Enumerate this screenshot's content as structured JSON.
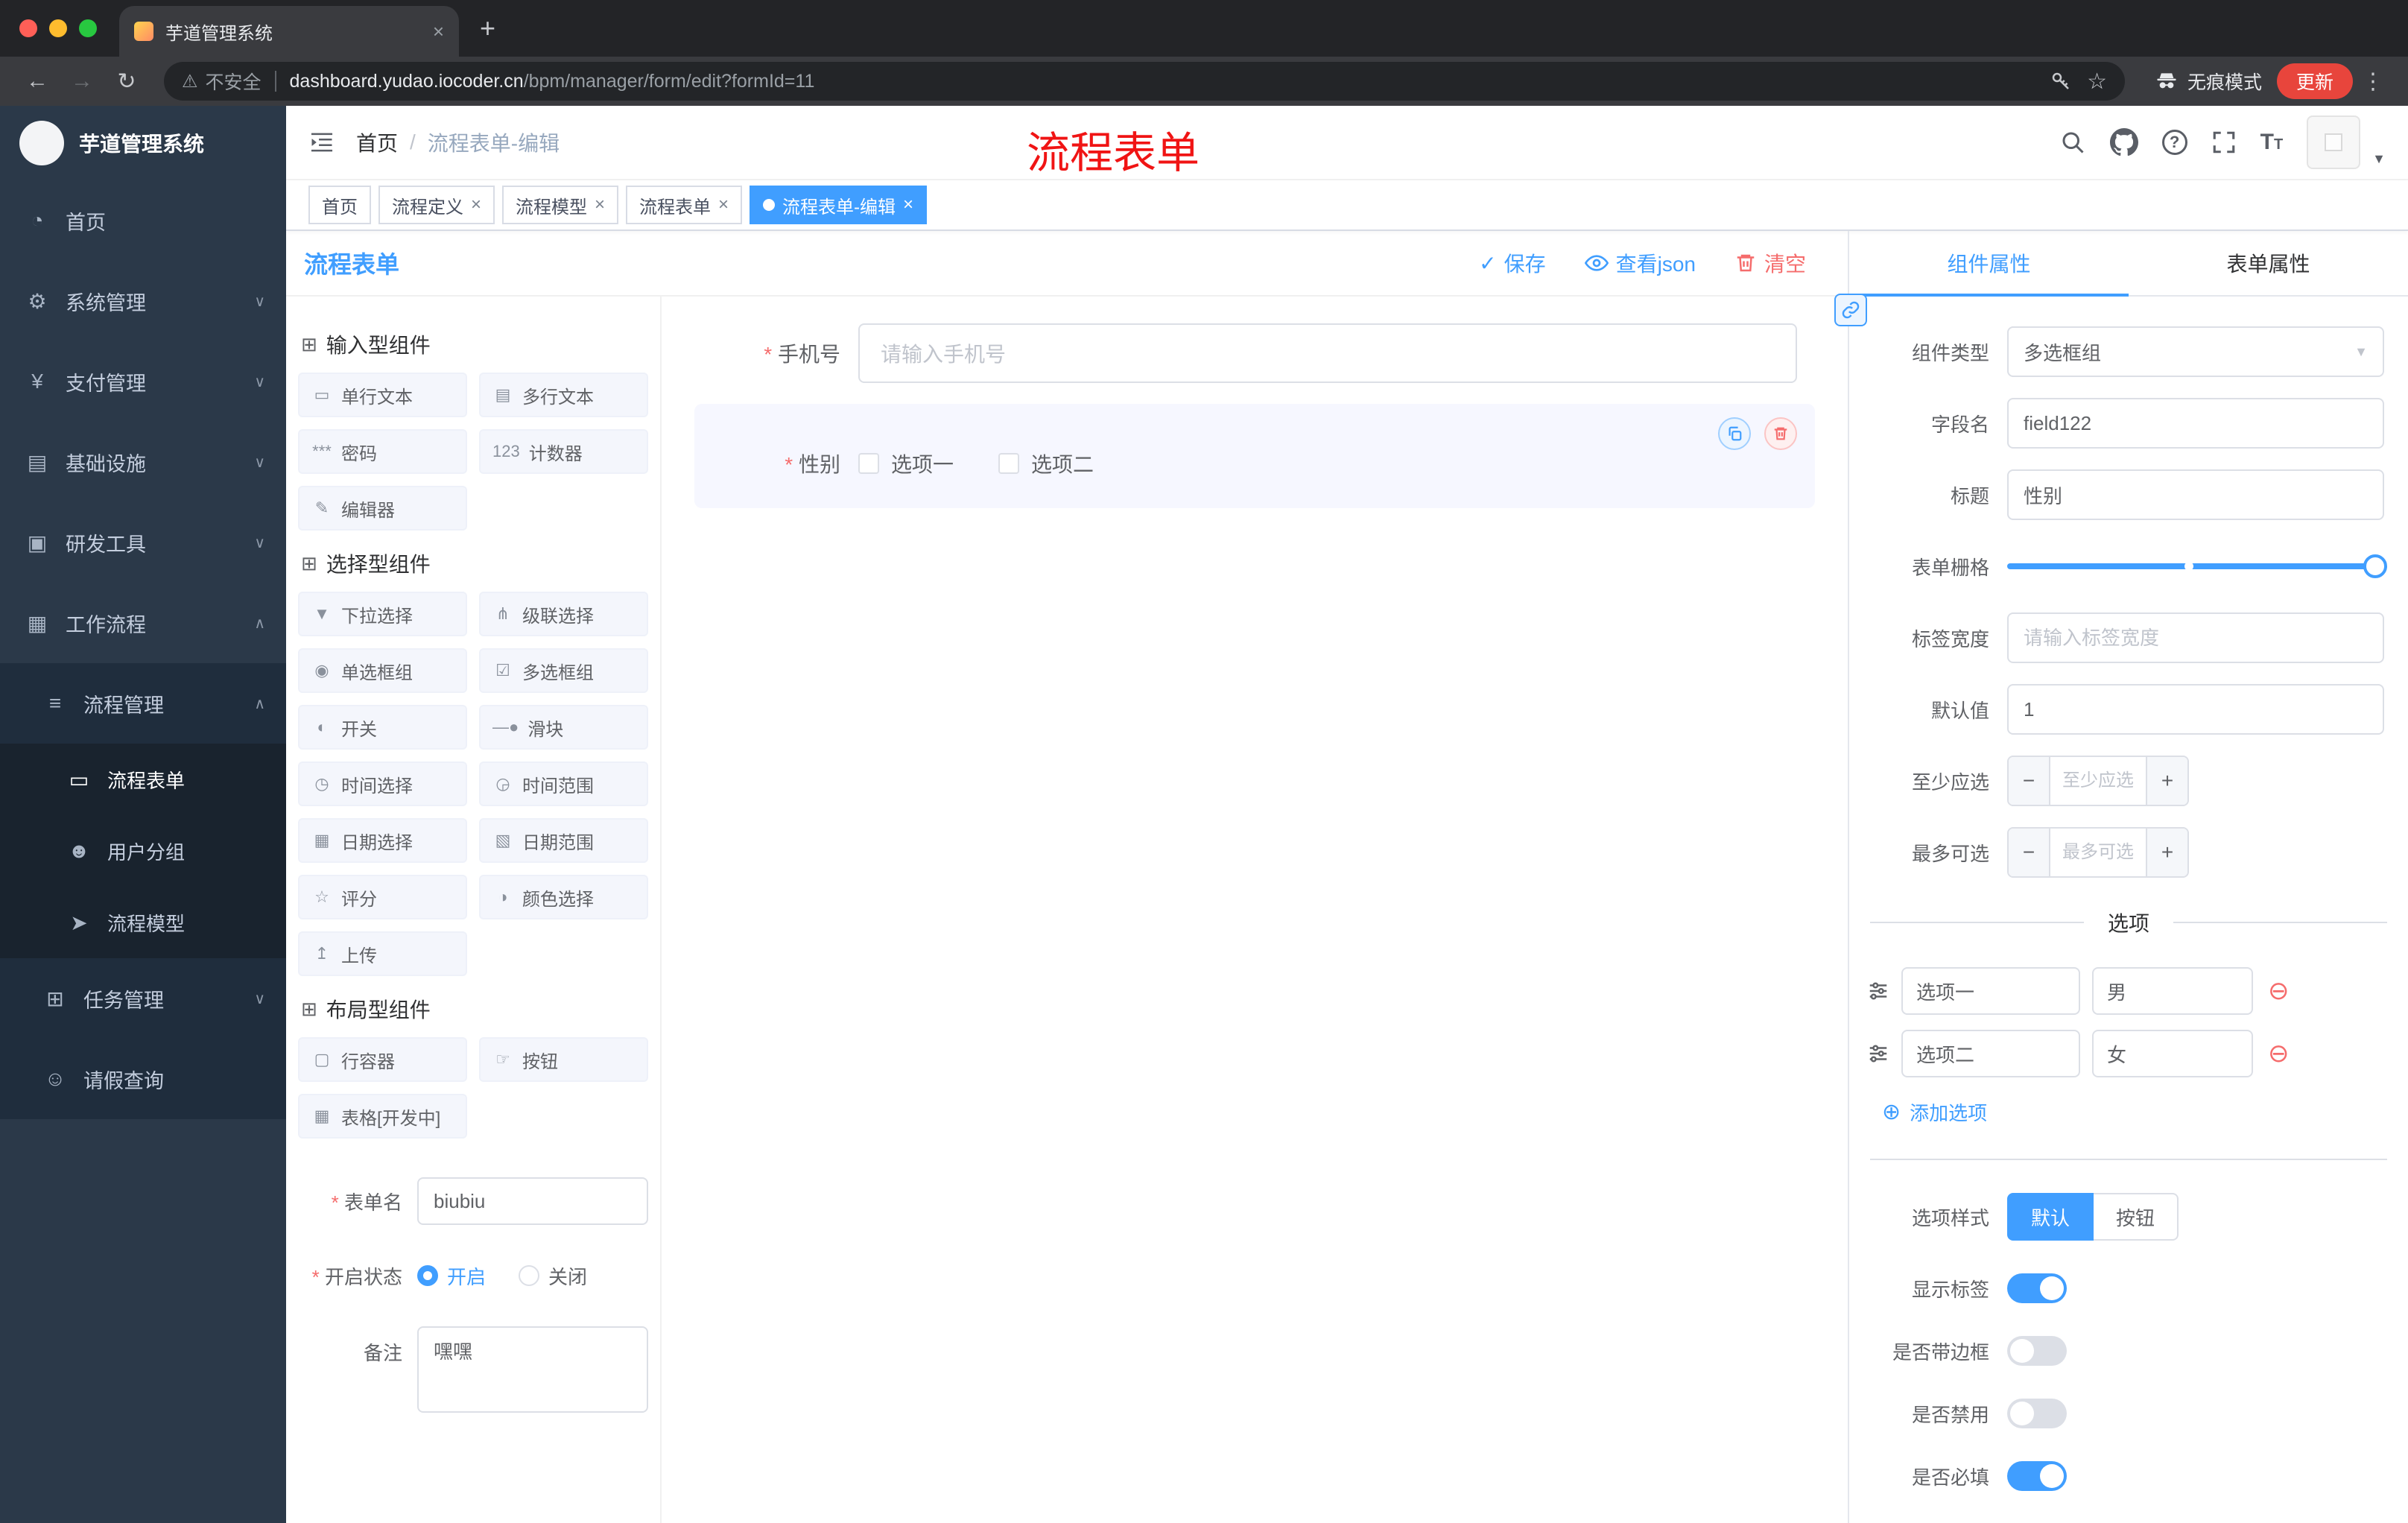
{
  "colors": {
    "accent": "#409eff",
    "danger": "#f56c6c",
    "watermark_red": "#f01414",
    "sidebar_bg": "#2b3949"
  },
  "browser": {
    "tab_title": "芋道管理系统",
    "security_label": "不安全",
    "url_host": "dashboard.yudao.iocoder.cn",
    "url_path": "/bpm/manager/form/edit?formId=11",
    "incognito_label": "无痕模式",
    "update_label": "更新"
  },
  "sidebar": {
    "logo_title": "芋道管理系统",
    "items": [
      {
        "icon": "◔",
        "label": "首页"
      },
      {
        "icon": "⚙",
        "label": "系统管理"
      },
      {
        "icon": "¥",
        "label": "支付管理"
      },
      {
        "icon": "▤",
        "label": "基础设施"
      },
      {
        "icon": "▣",
        "label": "研发工具"
      },
      {
        "icon": "▦",
        "label": "工作流程"
      },
      {
        "icon": "≡",
        "label": "流程管理"
      },
      {
        "icon": "▭",
        "label": "流程表单"
      },
      {
        "icon": "☻",
        "label": "用户分组"
      },
      {
        "icon": "➤",
        "label": "流程模型"
      },
      {
        "icon": "⊞",
        "label": "任务管理"
      },
      {
        "icon": "☺",
        "label": "请假查询"
      }
    ]
  },
  "header": {
    "breadcrumb_home": "首页",
    "breadcrumb_current": "流程表单-编辑",
    "watermark": "流程表单"
  },
  "tags": [
    {
      "label": "首页"
    },
    {
      "label": "流程定义"
    },
    {
      "label": "流程模型"
    },
    {
      "label": "流程表单"
    },
    {
      "label": "流程表单-编辑"
    }
  ],
  "designer": {
    "title": "流程表单",
    "toolbar": {
      "save": "保存",
      "view_json": "查看json",
      "clear": "清空"
    },
    "palette": {
      "groups": [
        {
          "title": "输入型组件",
          "items": [
            {
              "icon": "▭",
              "label": "单行文本"
            },
            {
              "icon": "▤",
              "label": "多行文本"
            },
            {
              "icon": "***",
              "label": "密码"
            },
            {
              "icon": "123",
              "label": "计数器"
            },
            {
              "icon": "✎",
              "label": "编辑器"
            }
          ]
        },
        {
          "title": "选择型组件",
          "items": [
            {
              "icon": "▼",
              "label": "下拉选择"
            },
            {
              "icon": "⋔",
              "label": "级联选择"
            },
            {
              "icon": "◉",
              "label": "单选框组"
            },
            {
              "icon": "☑",
              "label": "多选框组"
            },
            {
              "icon": "◐",
              "label": "开关"
            },
            {
              "icon": "—●",
              "label": "滑块"
            },
            {
              "icon": "◷",
              "label": "时间选择"
            },
            {
              "icon": "◶",
              "label": "时间范围"
            },
            {
              "icon": "▦",
              "label": "日期选择"
            },
            {
              "icon": "▧",
              "label": "日期范围"
            },
            {
              "icon": "☆",
              "label": "评分"
            },
            {
              "icon": "◑",
              "label": "颜色选择"
            },
            {
              "icon": "↥",
              "label": "上传"
            }
          ]
        },
        {
          "title": "布局型组件",
          "items": [
            {
              "icon": "▢",
              "label": "行容器"
            },
            {
              "icon": "☞",
              "label": "按钮"
            },
            {
              "icon": "▦",
              "label": "表格[开发中]"
            }
          ]
        }
      ]
    },
    "meta": {
      "form_name_label": "表单名",
      "form_name_value": "biubiu",
      "status_label": "开启状态",
      "status_on": "开启",
      "status_off": "关闭",
      "remark_label": "备注",
      "remark_value": "嘿嘿"
    },
    "canvas": {
      "phone": {
        "label": "手机号",
        "placeholder": "请输入手机号"
      },
      "gender": {
        "label": "性别",
        "options": [
          "选项一",
          "选项二"
        ]
      }
    },
    "props": {
      "tab_component": "组件属性",
      "tab_form": "表单属性",
      "component_type_label": "组件类型",
      "component_type_value": "多选框组",
      "field_name_label": "字段名",
      "field_name_value": "field122",
      "title_label": "标题",
      "title_value": "性别",
      "grid_label": "表单栅格",
      "label_width_label": "标签宽度",
      "label_width_placeholder": "请输入标签宽度",
      "default_label": "默认值",
      "default_value": "1",
      "min_label": "至少应选",
      "min_placeholder": "至少应选",
      "max_label": "最多可选",
      "max_placeholder": "最多可选",
      "options_title": "选项",
      "options": [
        {
          "label": "选项一",
          "value": "男"
        },
        {
          "label": "选项二",
          "value": "女"
        }
      ],
      "add_option": "添加选项",
      "style_label": "选项样式",
      "style_default": "默认",
      "style_button": "按钮",
      "switch_show_label": "显示标签",
      "switch_border": "是否带边框",
      "switch_disabled": "是否禁用",
      "switch_required": "是否必填"
    }
  }
}
